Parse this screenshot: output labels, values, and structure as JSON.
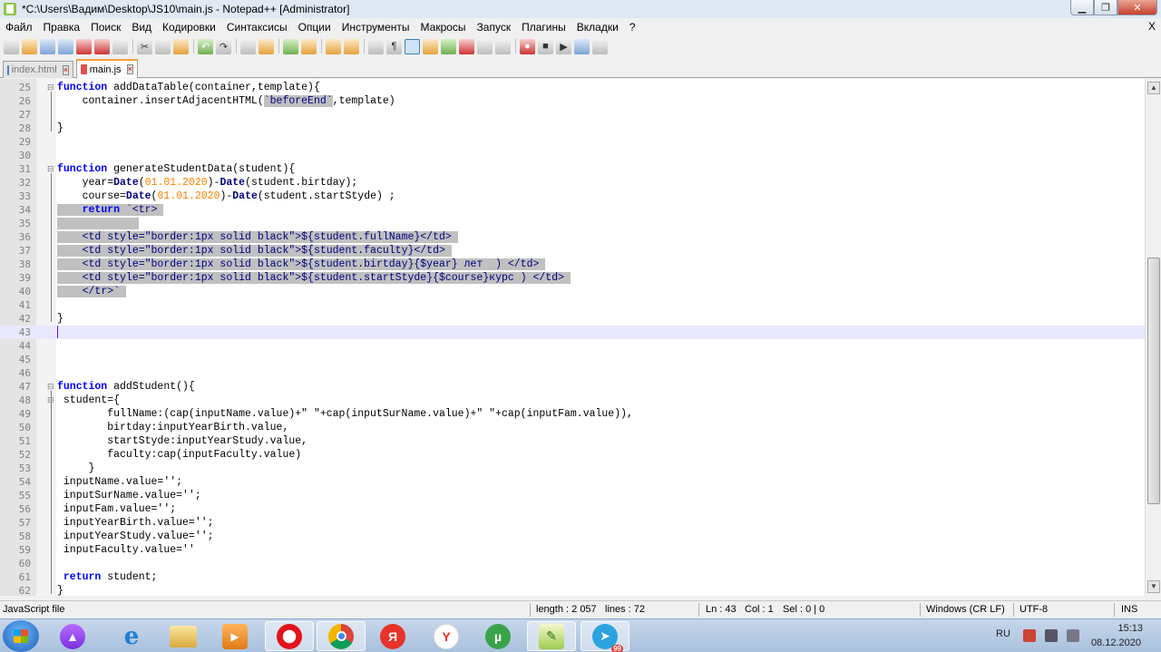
{
  "window": {
    "title": "*C:\\Users\\Вадим\\Desktop\\JS10\\main.js - Notepad++ [Administrator]"
  },
  "menu": {
    "items": [
      "Файл",
      "Правка",
      "Поиск",
      "Вид",
      "Кодировки",
      "Синтаксисы",
      "Опции",
      "Инструменты",
      "Макросы",
      "Запуск",
      "Плагины",
      "Вкладки",
      "?"
    ],
    "close": "X"
  },
  "tabs": [
    {
      "label": "index.html"
    },
    {
      "label": "main.js"
    }
  ],
  "editor": {
    "lines": [
      {
        "n": "25",
        "code": "function addDataTable(container,template){"
      },
      {
        "n": "26",
        "code": "    container.insertAdjacentHTML(`beforeEnd`,template)"
      },
      {
        "n": "27",
        "code": ""
      },
      {
        "n": "28",
        "code": "}"
      },
      {
        "n": "29",
        "code": ""
      },
      {
        "n": "30",
        "code": ""
      },
      {
        "n": "31",
        "code": "function generateStudentData(student){"
      },
      {
        "n": "32",
        "code": "    year=Date(01.01.2020)-Date(student.birtday);"
      },
      {
        "n": "33",
        "code": "    course=Date(01.01.2020)-Date(student.startStyde) ;"
      },
      {
        "n": "34",
        "code": "    return `<tr>"
      },
      {
        "n": "35",
        "code": ""
      },
      {
        "n": "36",
        "code": "    <td style=\"border:1px solid black\">${student.fullName}</td>"
      },
      {
        "n": "37",
        "code": "    <td style=\"border:1px solid black\">${student.faculty}</td>"
      },
      {
        "n": "38",
        "code": "    <td style=\"border:1px solid black\">${student.birtday}{$year} лет  ) </td>"
      },
      {
        "n": "39",
        "code": "    <td style=\"border:1px solid black\">${student.startStyde}{$course}курс ) </td>"
      },
      {
        "n": "40",
        "code": "    </tr>`"
      },
      {
        "n": "41",
        "code": ""
      },
      {
        "n": "42",
        "code": "}"
      },
      {
        "n": "43",
        "code": ""
      },
      {
        "n": "44",
        "code": ""
      },
      {
        "n": "45",
        "code": ""
      },
      {
        "n": "46",
        "code": ""
      },
      {
        "n": "47",
        "code": "function addStudent(){"
      },
      {
        "n": "48",
        "code": " student={"
      },
      {
        "n": "49",
        "code": "        fullName:(cap(inputName.value)+\" \"+cap(inputSurName.value)+\" \"+cap(inputFam.value)),"
      },
      {
        "n": "50",
        "code": "        birtday:inputYearBirth.value,"
      },
      {
        "n": "51",
        "code": "        startStyde:inputYearStudy.value,"
      },
      {
        "n": "52",
        "code": "        faculty:cap(inputFaculty.value)"
      },
      {
        "n": "53",
        "code": "     }"
      },
      {
        "n": "54",
        "code": " inputName.value='';"
      },
      {
        "n": "55",
        "code": " inputSurName.value='';"
      },
      {
        "n": "56",
        "code": " inputFam.value='';"
      },
      {
        "n": "57",
        "code": " inputYearBirth.value='';"
      },
      {
        "n": "58",
        "code": " inputYearStudy.value='';"
      },
      {
        "n": "59",
        "code": " inputFaculty.value=''"
      },
      {
        "n": "60",
        "code": ""
      },
      {
        "n": "61",
        "code": " return student;"
      },
      {
        "n": "62",
        "code": "}"
      }
    ]
  },
  "status": {
    "file_type": "JavaScript file",
    "length": "length : 2 057",
    "lines": "lines : 72",
    "ln": "Ln : 43",
    "col": "Col : 1",
    "sel": "Sel : 0 | 0",
    "eol": "Windows (CR LF)",
    "encoding": "UTF-8",
    "mode": "INS"
  },
  "taskbar": {
    "lang": "RU",
    "time": "15:13",
    "date": "08.12.2020",
    "badge": "99"
  },
  "colors": {
    "keyword": "#0000ff",
    "number": "#ff8000",
    "selection": "#c0c0c0",
    "current_line": "#e8e8ff",
    "tab_accent": "#f9a038"
  }
}
